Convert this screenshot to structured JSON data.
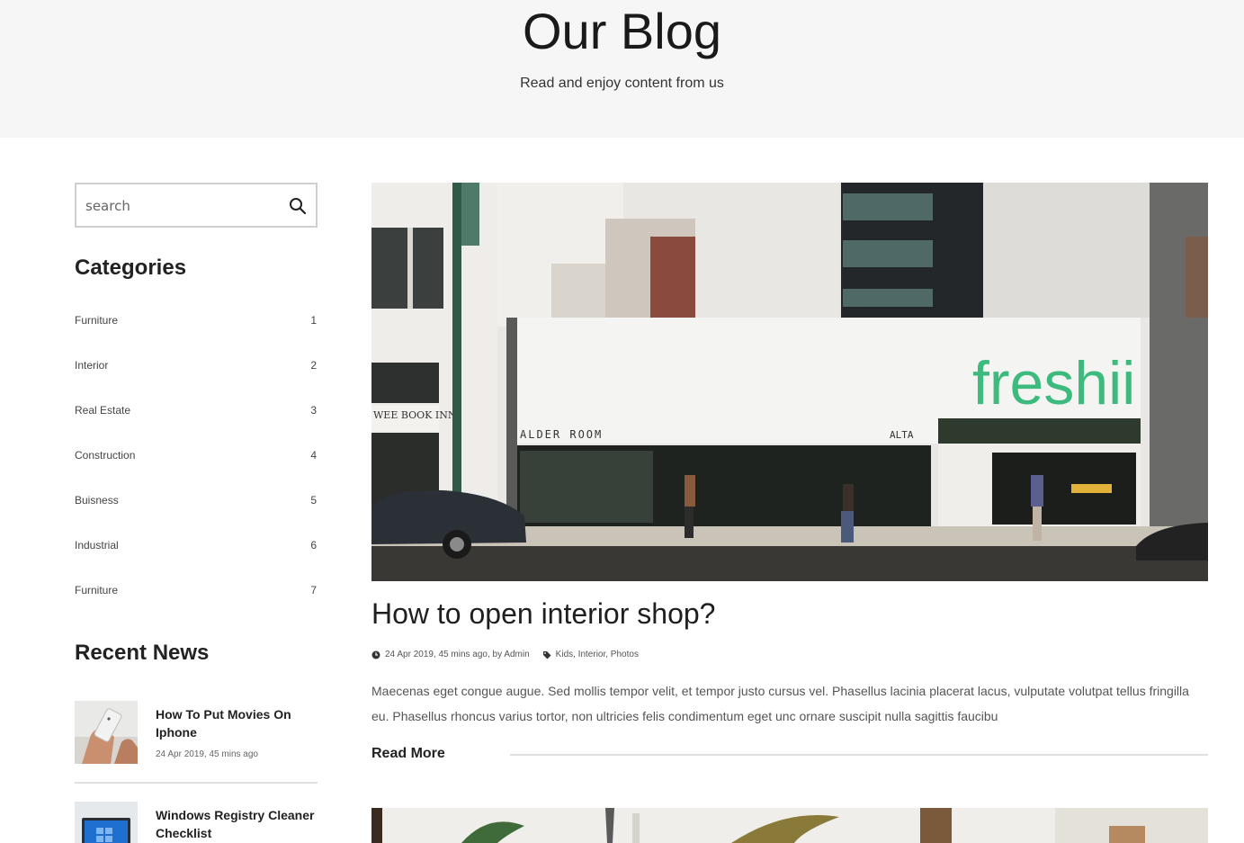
{
  "hero": {
    "title": "Our Blog",
    "subtitle": "Read and enjoy content from us"
  },
  "search": {
    "placeholder": "search",
    "icon": "search-icon"
  },
  "categories": {
    "title": "Categories",
    "items": [
      {
        "name": "Furniture",
        "count": "1"
      },
      {
        "name": "Interior",
        "count": "2"
      },
      {
        "name": "Real Estate",
        "count": "3"
      },
      {
        "name": "Construction",
        "count": "4"
      },
      {
        "name": "Buisness",
        "count": "5"
      },
      {
        "name": "Industrial",
        "count": "6"
      },
      {
        "name": "Furniture",
        "count": "7"
      }
    ]
  },
  "recent_news": {
    "title": "Recent News",
    "items": [
      {
        "title": "How To Put Movies On Iphone",
        "date": "24 Apr 2019, 45 mins ago"
      },
      {
        "title": "Windows Registry Cleaner Checklist",
        "date": ""
      }
    ]
  },
  "post": {
    "title": "How to open interior shop?",
    "meta_date": "24 Apr 2019, 45 mins ago, by Admin",
    "meta_tags": "Kids, Interior, Photos",
    "excerpt": "Maecenas eget congue augue. Sed mollis tempor velit, et tempor justo cursus vel. Phasellus lacinia placerat lacus, vulputate volutpat tellus fringilla eu. Phasellus rhoncus varius tortor, non ultricies felis condimentum eget unc ornare suscipit nulla sagittis faucibu",
    "read_more": "Read More",
    "image_sign_main": "freshii",
    "image_sign_left": "ALDER ROOM",
    "image_sign_right": "ALTA",
    "image_sign_corner": "WEE BOOK INN"
  },
  "colors": {
    "hero_bg": "#f6f6f6",
    "sign_green": "#3dbb7e",
    "divider": "#e0e0e0"
  }
}
